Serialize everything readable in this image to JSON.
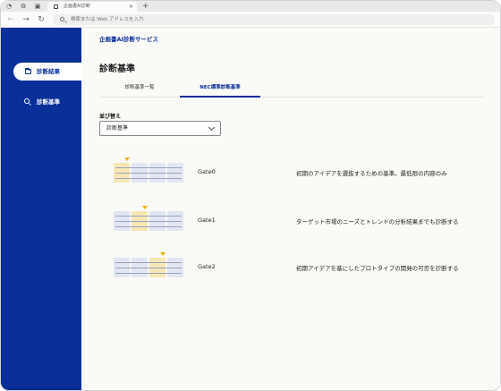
{
  "browser": {
    "tab_title": "企画書AI診断",
    "url_placeholder": "検索または Web アドレスを入力",
    "new_tab_symbol": "+",
    "tab_close_symbol": "×",
    "back_symbol": "←",
    "forward_symbol": "→",
    "reload_symbol": "↻"
  },
  "app": {
    "service_name": "企画書AI診断サービス",
    "page_title": "診断基準"
  },
  "sidebar": {
    "items": [
      {
        "label": "診断結果",
        "icon": "folder-icon",
        "active": true
      },
      {
        "label": "診断基準",
        "icon": "zoom-search-icon",
        "active": false
      }
    ]
  },
  "tabs": [
    {
      "label": "診断基準一覧",
      "selected": false
    },
    {
      "label": "NEC標準診断基準",
      "selected": true
    }
  ],
  "sort": {
    "label": "並び替え",
    "selected_value": "診断基準"
  },
  "gates": [
    {
      "name": "Gate0",
      "description": "初期のアイデアを選抜するための基準。最低限の内容のみ"
    },
    {
      "name": "Gate1",
      "description": "ターゲット市場のニーズとトレンドの分析結果までも診断する"
    },
    {
      "name": "Gate2",
      "description": "初期アイデアを基にしたプロトタイプの開発の可否を診断する"
    }
  ],
  "colors": {
    "brand_blue": "#0a2f99",
    "accent_yellow": "#e3b613",
    "background": "#fafaf6"
  }
}
